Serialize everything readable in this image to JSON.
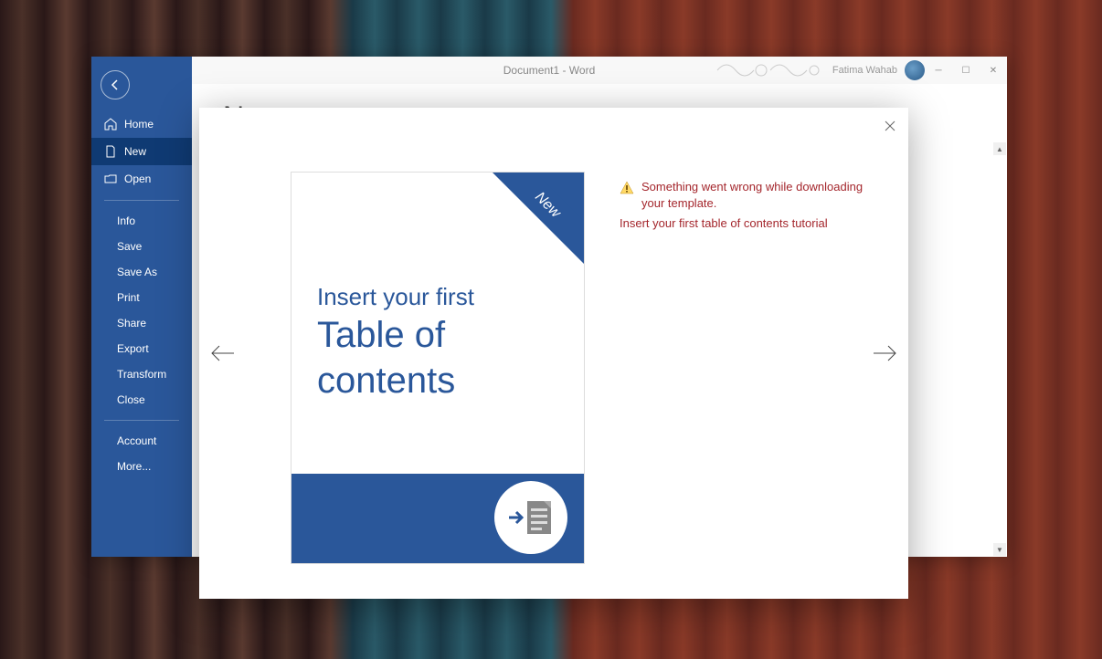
{
  "window": {
    "title": "Document1  -  Word",
    "user_name": "Fatima Wahab"
  },
  "sidebar": {
    "home": "Home",
    "new": "New",
    "open": "Open",
    "sub": {
      "info": "Info",
      "save": "Save",
      "save_as": "Save As",
      "print": "Print",
      "share": "Share",
      "export": "Export",
      "transform": "Transform",
      "close": "Close"
    },
    "account": "Account",
    "more": "More..."
  },
  "page": {
    "title": "New"
  },
  "modal": {
    "ribbon": "New",
    "preview_line1": "Insert your first",
    "preview_line2": "Table of",
    "preview_line3": "contents",
    "error_main": "Something went wrong while downloading your template.",
    "error_name": "Insert your first table of contents tutorial"
  }
}
